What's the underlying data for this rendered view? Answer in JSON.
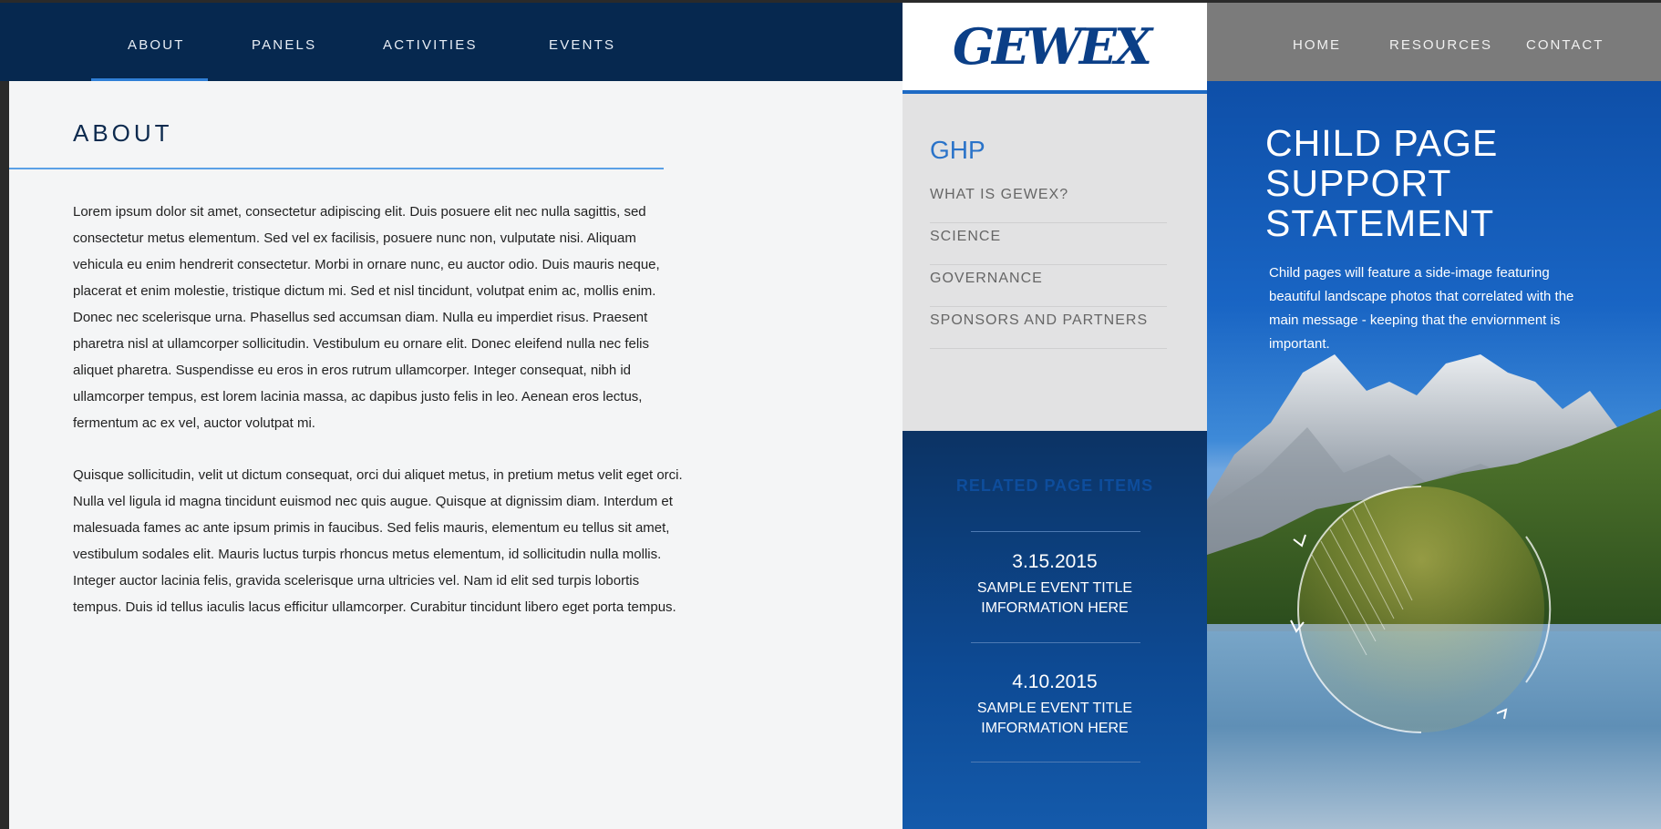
{
  "header": {
    "left_nav": [
      {
        "label": "ABOUT",
        "active": true
      },
      {
        "label": "PANELS"
      },
      {
        "label": "ACTIVITIES"
      },
      {
        "label": "EVENTS"
      }
    ],
    "logo": "GEWEX",
    "right_nav": [
      {
        "label": "HOME"
      },
      {
        "label": "RESOURCES"
      },
      {
        "label": "CONTACT"
      }
    ]
  },
  "main": {
    "title": "ABOUT",
    "paragraphs": [
      "Lorem ipsum dolor sit amet, consectetur adipiscing elit. Duis posuere elit nec nulla sagittis, sed consectetur metus elementum. Sed vel ex facilisis, posuere nunc non, vulputate nisi. Aliquam vehicula eu enim hendrerit consectetur. Morbi in ornare nunc, eu auctor odio. Duis mauris neque, placerat et enim molestie, tristique dictum mi. Sed et nisl tincidunt, volutpat enim ac, mollis enim. Donec nec scelerisque urna. Phasellus sed accumsan diam. Nulla eu imperdiet risus. Praesent pharetra nisl at ullamcorper sollicitudin. Vestibulum eu ornare elit. Donec eleifend nulla nec felis aliquet pharetra. Suspendisse eu eros in eros rutrum ullamcorper. Integer consequat, nibh id ullamcorper tempus, est lorem lacinia massa, ac dapibus justo felis in leo. Aenean eros lectus, fermentum ac ex vel, auctor volutpat mi.",
      "Quisque sollicitudin, velit ut dictum consequat, orci dui aliquet metus, in pretium metus velit eget orci. Nulla vel ligula id magna tincidunt euismod nec quis augue. Quisque at dignissim diam. Interdum et malesuada fames ac ante ipsum primis in faucibus. Sed felis mauris, elementum eu tellus sit amet, vestibulum sodales elit. Mauris luctus turpis rhoncus metus elementum, id sollicitudin nulla mollis. Integer auctor lacinia felis, gravida scelerisque urna ultricies vel. Nam id elit sed turpis lobortis tempus. Duis id tellus iaculis lacus efficitur ullamcorper. Curabitur tincidunt libero eget porta tempus."
    ]
  },
  "sidebar": {
    "title": "GHP",
    "items": [
      {
        "label": "WHAT IS GEWEX?"
      },
      {
        "label": "SCIENCE"
      },
      {
        "label": "GOVERNANCE"
      },
      {
        "label": "SPONSORS AND PARTNERS"
      }
    ]
  },
  "related": {
    "title": "RELATED PAGE ITEMS",
    "events": [
      {
        "date": "3.15.2015",
        "title": "SAMPLE EVENT TITLE\nIMFORMATION HERE"
      },
      {
        "date": "4.10.2015",
        "title": "SAMPLE EVENT TITLE\nIMFORMATION HERE"
      }
    ]
  },
  "hero": {
    "title": "CHILD PAGE\nSUPPORT\nSTATEMENT",
    "body": "Child pages will feature a side-image featuring beautiful landscape photos that correlated with the main message - keeping that the enviornment is important."
  },
  "colors": {
    "nav_dark": "#06284f",
    "accent_blue": "#2a73c9",
    "right_nav_gray": "#7b7b7b",
    "sidebar_gray": "#e2e2e3"
  }
}
